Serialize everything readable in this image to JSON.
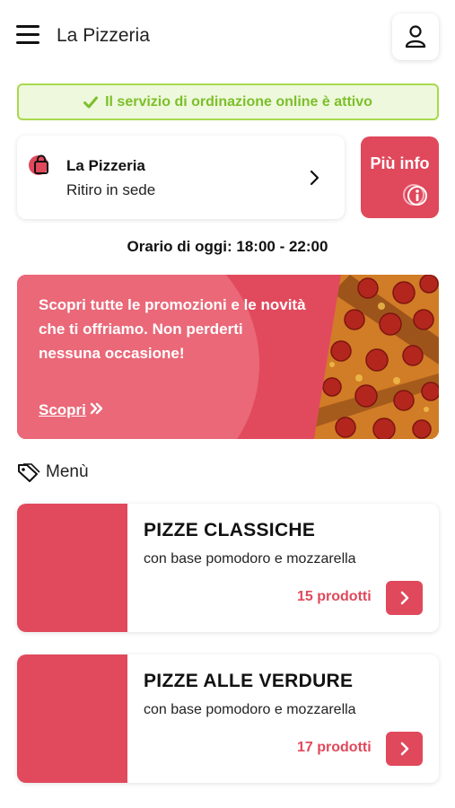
{
  "header": {
    "title": "La Pizzeria",
    "menu_icon": "hamburger-icon",
    "profile_icon": "user-icon"
  },
  "status": {
    "text": "Il servizio di ordinazione online è attivo",
    "icon": "check-icon",
    "color": "#7cbf2a"
  },
  "store": {
    "name": "La Pizzeria",
    "mode": "Ritiro in sede",
    "icon": "shopping-bag-icon"
  },
  "info_button": {
    "label": "Più info",
    "icon": "info-icon"
  },
  "hours": {
    "text": "Orario di oggi: 18:00 - 22:00"
  },
  "promo": {
    "text": "Scopri tutte le promozioni e le novità che ti offriamo. Non perderti nessuna occasione!",
    "link": "Scopri",
    "link_icon": "double-chevron-right-icon"
  },
  "menu": {
    "heading": "Menù",
    "icon": "tag-icon",
    "categories": [
      {
        "title": "PIZZE CLASSICHE",
        "description": "con base pomodoro e mozzarella",
        "count": "15 prodotti"
      },
      {
        "title": "PIZZE ALLE VERDURE",
        "description": "con base pomodoro e mozzarella",
        "count": "17 prodotti"
      }
    ]
  },
  "colors": {
    "accent": "#e0485b",
    "status_border": "#a8d94e",
    "status_bg": "#eef8dc"
  }
}
